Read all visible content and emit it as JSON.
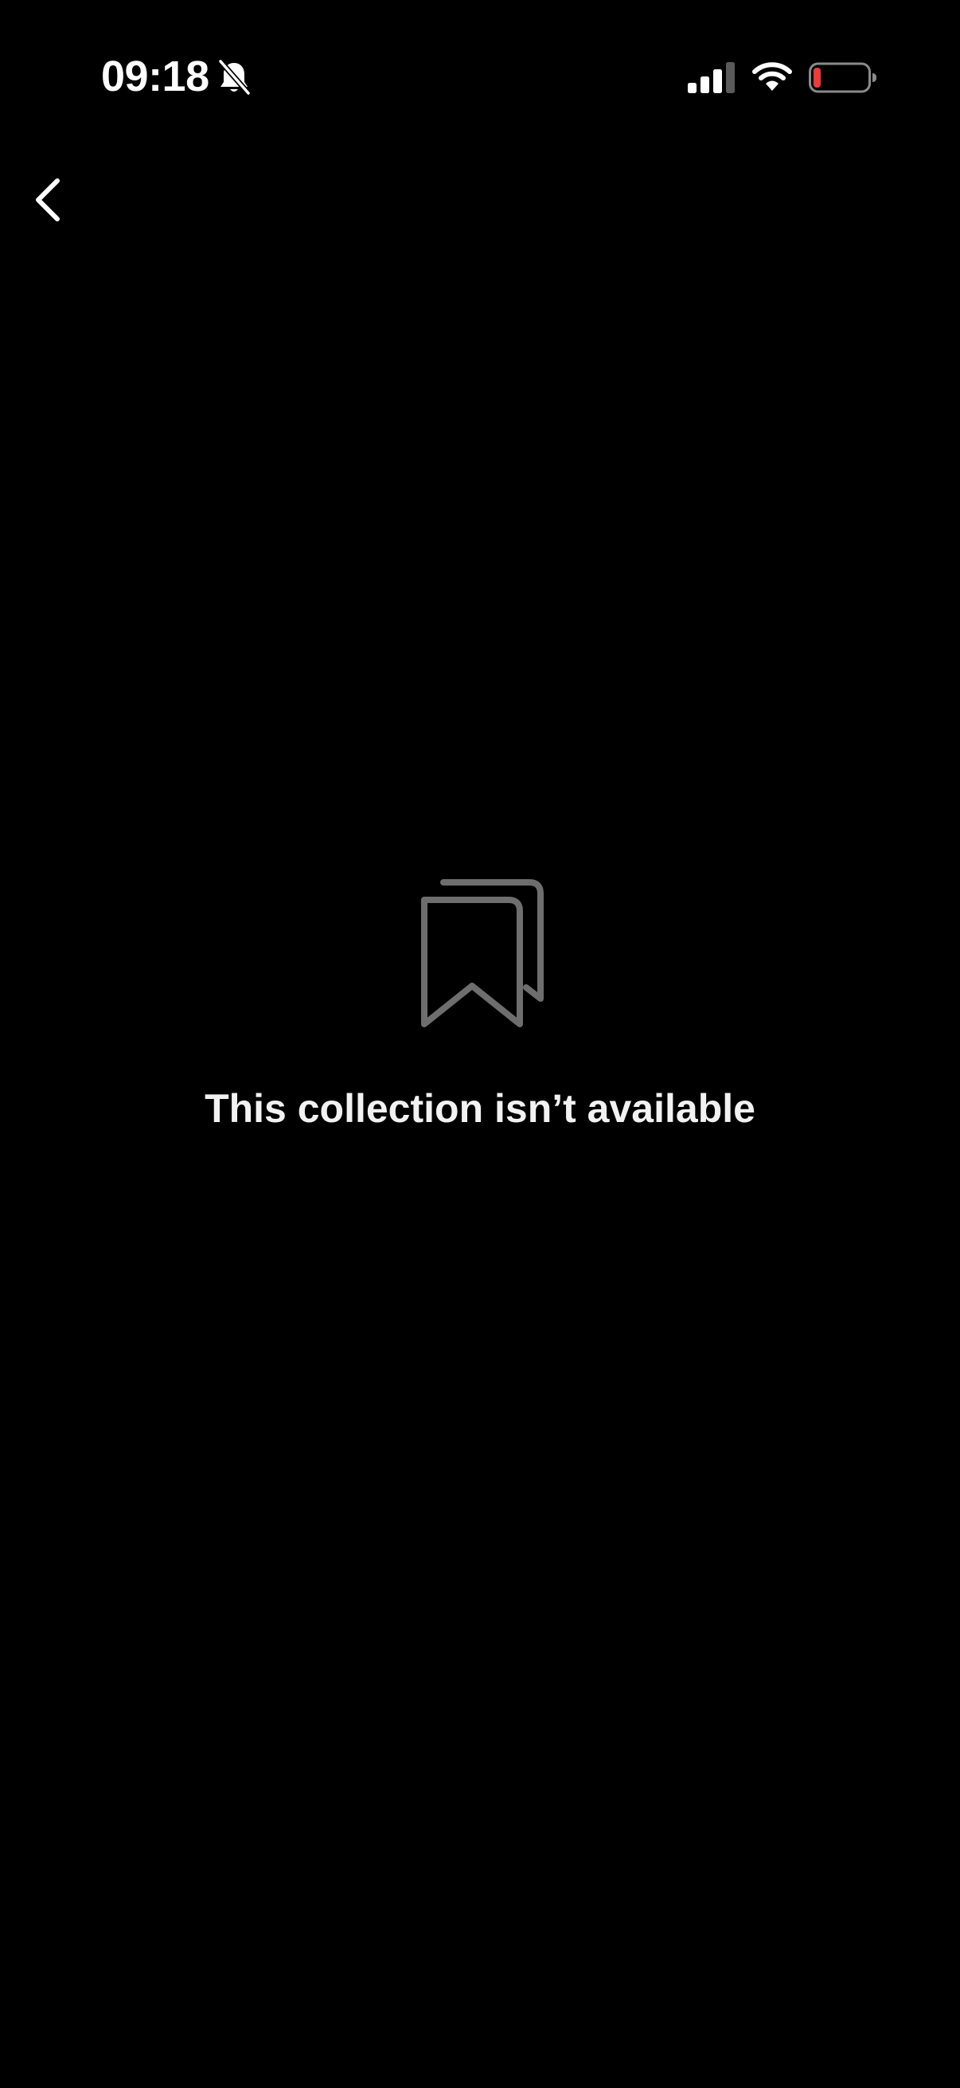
{
  "status_bar": {
    "time": "09:18",
    "icons": {
      "silent": "bell-slash-icon",
      "signal": "cellular-signal-icon",
      "wifi": "wifi-icon",
      "battery": "battery-low-icon"
    },
    "battery_color": "#eb3b3b"
  },
  "navigation": {
    "back_icon": "chevron-left-icon"
  },
  "empty_state": {
    "icon": "bookmarks-icon",
    "icon_color": "#6e6e6e",
    "message": "This collection isn’t available"
  },
  "colors": {
    "background": "#000000",
    "text": "#f2f2f2"
  }
}
